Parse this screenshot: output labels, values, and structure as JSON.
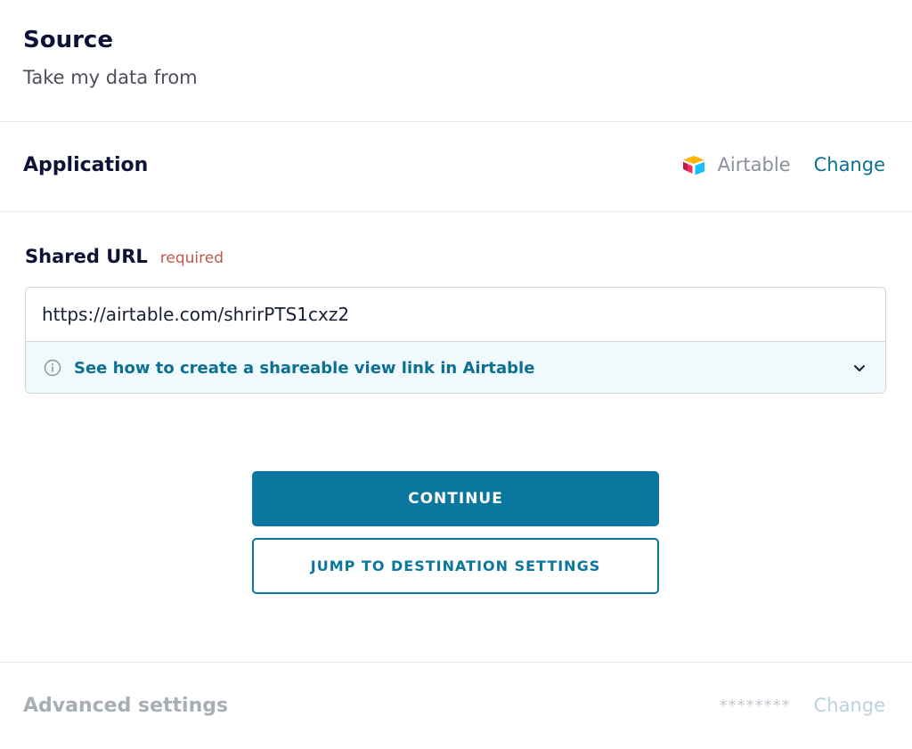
{
  "header": {
    "title": "Source",
    "subtitle": "Take my data from"
  },
  "application": {
    "label": "Application",
    "selected_app": "Airtable",
    "app_icon": "airtable-logo-icon",
    "change_label": "Change"
  },
  "shared_url": {
    "label": "Shared URL",
    "required_tag": "required",
    "value": "https://airtable.com/shrirPTS1cxz2",
    "help_text": "See how to create a shareable view link in Airtable",
    "help_icon": "info-icon",
    "expand_icon": "chevron-down-icon"
  },
  "actions": {
    "continue_label": "CONTINUE",
    "jump_label": "JUMP TO DESTINATION SETTINGS"
  },
  "advanced": {
    "label": "Advanced settings",
    "masked_value": "********",
    "change_label": "Change"
  },
  "colors": {
    "primary": "#0b769e",
    "link": "#0c6f94",
    "required": "#c1584a",
    "help_bg": "#f0f9fc"
  }
}
